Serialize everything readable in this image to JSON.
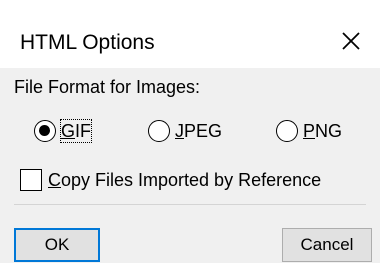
{
  "window": {
    "title": "HTML Options",
    "close_icon": "close-icon"
  },
  "image_format": {
    "label": "File Format for Images:",
    "selected": "GIF",
    "options": [
      {
        "mnemonic": "G",
        "rest": "IF",
        "checked": true
      },
      {
        "mnemonic": "J",
        "rest": "PEG",
        "checked": false
      },
      {
        "mnemonic": "P",
        "rest": "NG",
        "checked": false
      }
    ]
  },
  "copy_files": {
    "mnemonic": "C",
    "rest": "opy Files Imported by Reference",
    "checked": false
  },
  "buttons": {
    "ok": "OK",
    "cancel": "Cancel"
  },
  "colors": {
    "focus_border": "#0078d7",
    "body_background": "#f0f0f0",
    "title_background": "#ffffff"
  }
}
